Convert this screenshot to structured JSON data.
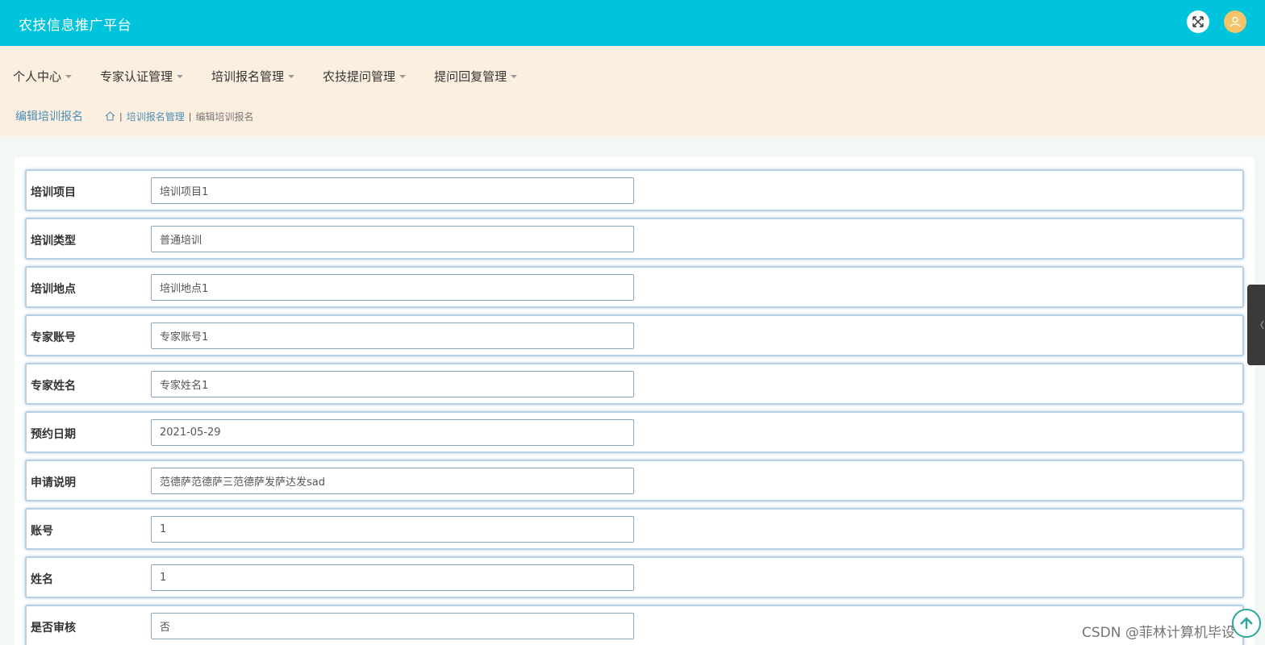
{
  "header": {
    "app_title": "农技信息推广平台",
    "icons": [
      "fullscreen-icon",
      "user-icon"
    ],
    "colors": {
      "topbar": "#00c3dc",
      "navbar": "#fdefdf",
      "link": "#4a8fb6"
    }
  },
  "menu": [
    {
      "label": "个人中心"
    },
    {
      "label": "专家认证管理"
    },
    {
      "label": "培训报名管理"
    },
    {
      "label": "农技提问管理"
    },
    {
      "label": "提问回复管理"
    }
  ],
  "page": {
    "title": "编辑培训报名",
    "breadcrumb": [
      {
        "label": "培训报名管理"
      },
      {
        "label": "编辑培训报名"
      }
    ]
  },
  "form": {
    "fields": [
      {
        "label": "培训项目",
        "value": "培训项目1"
      },
      {
        "label": "培训类型",
        "value": "普通培训"
      },
      {
        "label": "培训地点",
        "value": "培训地点1"
      },
      {
        "label": "专家账号",
        "value": "专家账号1"
      },
      {
        "label": "专家姓名",
        "value": "专家姓名1"
      },
      {
        "label": "预约日期",
        "value": "2021-05-29"
      },
      {
        "label": "申请说明",
        "value": "范德萨范德萨三范德萨发萨达发sad"
      },
      {
        "label": "账号",
        "value": "1"
      },
      {
        "label": "姓名",
        "value": "1"
      },
      {
        "label": "是否审核",
        "value": "否"
      }
    ]
  },
  "watermark": "CSDN @菲林计算机毕设"
}
